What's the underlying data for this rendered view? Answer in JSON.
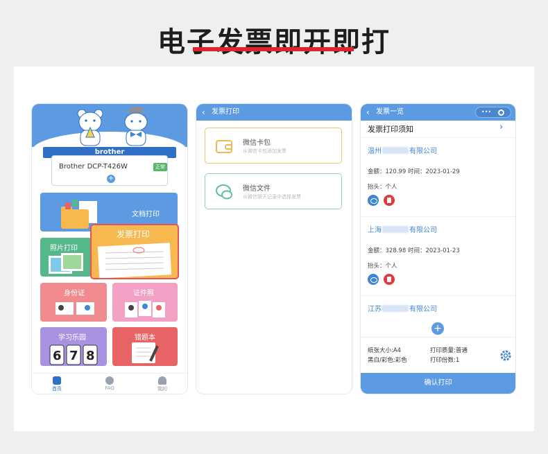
{
  "headline": "电子发票即开即打",
  "colors": {
    "accent": "#e0242f",
    "primary": "#5c9be2",
    "primary_dark": "#2f6fc7",
    "success": "#56b66a",
    "danger": "#e23a3a"
  },
  "home": {
    "brand": "brother",
    "printer_name": "Brother DCP-T426W",
    "printer_status": "正常",
    "add_icon": "plus-icon",
    "tiles": {
      "doc": "文档打印",
      "photo": "照片打印",
      "invoice": "发票打印",
      "id": "身份证",
      "cert": "证件照",
      "study": "学习乐园",
      "wrong": "错题本"
    },
    "tabbar": [
      {
        "label": "首页",
        "icon": "printer-icon"
      },
      {
        "label": "FAQ",
        "icon": "question-icon"
      },
      {
        "label": "我的",
        "icon": "user-icon"
      }
    ]
  },
  "invoice_source": {
    "title": "发票打印",
    "options": [
      {
        "title": "微信卡包",
        "subtitle": "从微信卡包添加发票",
        "icon": "wallet-icon"
      },
      {
        "title": "微信文件",
        "subtitle": "从微信聊天记录中选择发票",
        "icon": "chat-icon"
      }
    ]
  },
  "invoice_list": {
    "title": "发票一览",
    "capsule_dots": "•••",
    "notice": "发票打印须知",
    "invoices": [
      {
        "company_prefix": "温州",
        "company_suffix": "有限公司",
        "amount_line": "金额：120.99  时间：2023-01-29",
        "header_line": "抬头：个人"
      },
      {
        "company_prefix": "上海",
        "company_suffix": "有限公司",
        "amount_line": "金额：328.98  时间：2023-01-23",
        "header_line": "抬头：个人"
      },
      {
        "company_prefix": "江苏",
        "company_suffix": "有限公司"
      }
    ],
    "settings": {
      "paper": "纸张大小:A4",
      "quality": "打印质量:普通",
      "color": "黑白/彩色:彩色",
      "copies": "打印份数:1"
    },
    "confirm": "确认打印"
  }
}
